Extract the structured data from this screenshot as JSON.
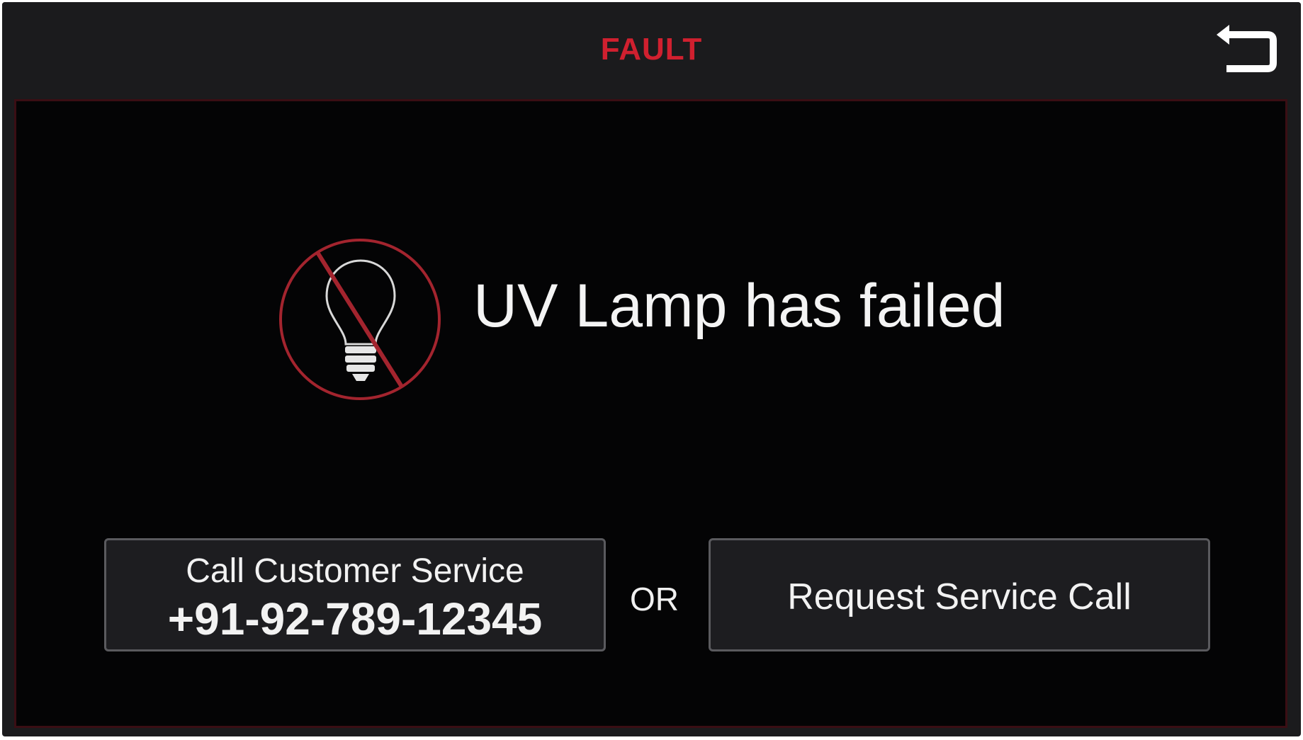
{
  "header": {
    "title": "FAULT",
    "back_icon": "back-arrow-icon"
  },
  "fault": {
    "icon": "lamp-failed-icon",
    "message": "UV Lamp has failed"
  },
  "actions": {
    "call": {
      "label": "Call Customer Service",
      "number": "+91-92-789-12345"
    },
    "separator": "OR",
    "request": {
      "label": "Request Service Call"
    }
  },
  "colors": {
    "title": "#d0202f",
    "icon_ring": "#a3242e",
    "background": "#040405",
    "bar": "#1b1b1d",
    "text": "#f4f4f4"
  }
}
